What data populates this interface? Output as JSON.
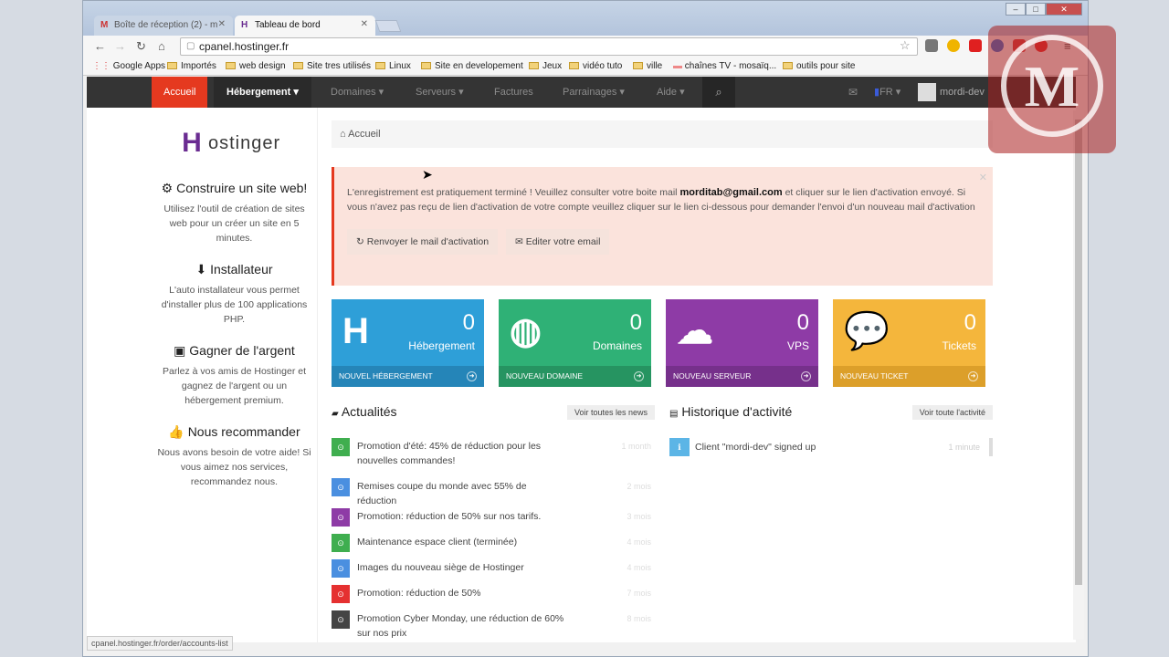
{
  "browser": {
    "tabs": [
      {
        "title": "Boîte de réception (2) - m",
        "favicon": "M"
      },
      {
        "title": "Tableau de bord",
        "favicon": "H"
      }
    ],
    "address": "cpanel.hostinger.fr",
    "bookmarks": [
      "Google Apps",
      "Importés",
      "web design",
      "Site tres utilisés",
      "Linux",
      "Site en developement",
      "Jeux",
      "vidéo tuto",
      "ville",
      "chaînes TV - mosaïq...",
      "outils pour site"
    ],
    "status_url": "cpanel.hostinger.fr/order/accounts-list"
  },
  "nav": {
    "items": [
      "Accueil",
      "Hébergement",
      "Domaines",
      "Serveurs",
      "Factures",
      "Parrainages",
      "Aide"
    ],
    "lang": "FR",
    "user": "mordi-dev"
  },
  "sidebar": {
    "logo": "ostinger",
    "blocks": [
      {
        "title": "Construire un site web!",
        "text": "Utilisez l'outil de création de sites web pour un créer un site en 5 minutes."
      },
      {
        "title": "Installateur",
        "text": "L'auto installateur vous permet d'installer plus de 100 applications PHP."
      },
      {
        "title": "Gagner de l'argent",
        "text": "Parlez à vos amis de Hostinger et gagnez de l'argent ou un hébergement premium."
      },
      {
        "title": "Nous recommander",
        "text": "Nous avons besoin de votre aide! Si vous aimez nos services, recommandez nous."
      }
    ]
  },
  "breadcrumb": "Accueil",
  "alert": {
    "pre": "L'enregistrement est pratiquement terminé ! Veuillez consulter votre boite mail",
    "email": "morditab@gmail.com",
    "post": "et cliquer sur le lien d'activation envoyé. Si vous n'avez pas reçu de lien d'activation de votre compte veuillez cliquer sur le lien ci-dessous pour demander l'envoi d'un nouveau mail d'activation",
    "btn_resend": "Renvoyer le mail d'activation",
    "btn_edit": "Editer votre email"
  },
  "tiles": [
    {
      "count": "0",
      "label": "Hébergement",
      "footer": "NOUVEL HÉBERGEMENT",
      "color": "#2e9fd8"
    },
    {
      "count": "0",
      "label": "Domaines",
      "footer": "NOUVEAU DOMAINE",
      "color": "#2fb176"
    },
    {
      "count": "0",
      "label": "VPS",
      "footer": "NOUVEAU SERVEUR",
      "color": "#8e3ba6"
    },
    {
      "count": "0",
      "label": "Tickets",
      "footer": "NOUVEAU TICKET",
      "color": "#f4b63c"
    }
  ],
  "news": {
    "title": "Actualités",
    "button": "Voir toutes les news",
    "items": [
      {
        "text": "Promotion d'été: 45% de réduction pour les nouvelles commandes!",
        "date": "1 month",
        "color": "#3fae4f"
      },
      {
        "text": "Remises coupe du monde avec 55% de réduction",
        "date": "2 mois",
        "color": "#4a8fe0"
      },
      {
        "text": "Promotion: réduction de 50% sur nos tarifs.",
        "date": "3 mois",
        "color": "#8e3ba6"
      },
      {
        "text": "Maintenance espace client (terminée)",
        "date": "4 mois",
        "color": "#3fae4f"
      },
      {
        "text": "Images du nouveau siège de Hostinger",
        "date": "4 mois",
        "color": "#4a8fe0"
      },
      {
        "text": "Promotion: réduction de 50%",
        "date": "7 mois",
        "color": "#e53030"
      },
      {
        "text": "Promotion Cyber Monday, une réduction de 60% sur nos prix",
        "date": "8 mois",
        "color": "#444444"
      }
    ]
  },
  "activity": {
    "title": "Historique d'activité",
    "button": "Voir toute l'activité",
    "items": [
      {
        "text": "Client \"mordi-dev\" signed up",
        "date": "1 minute"
      }
    ]
  }
}
